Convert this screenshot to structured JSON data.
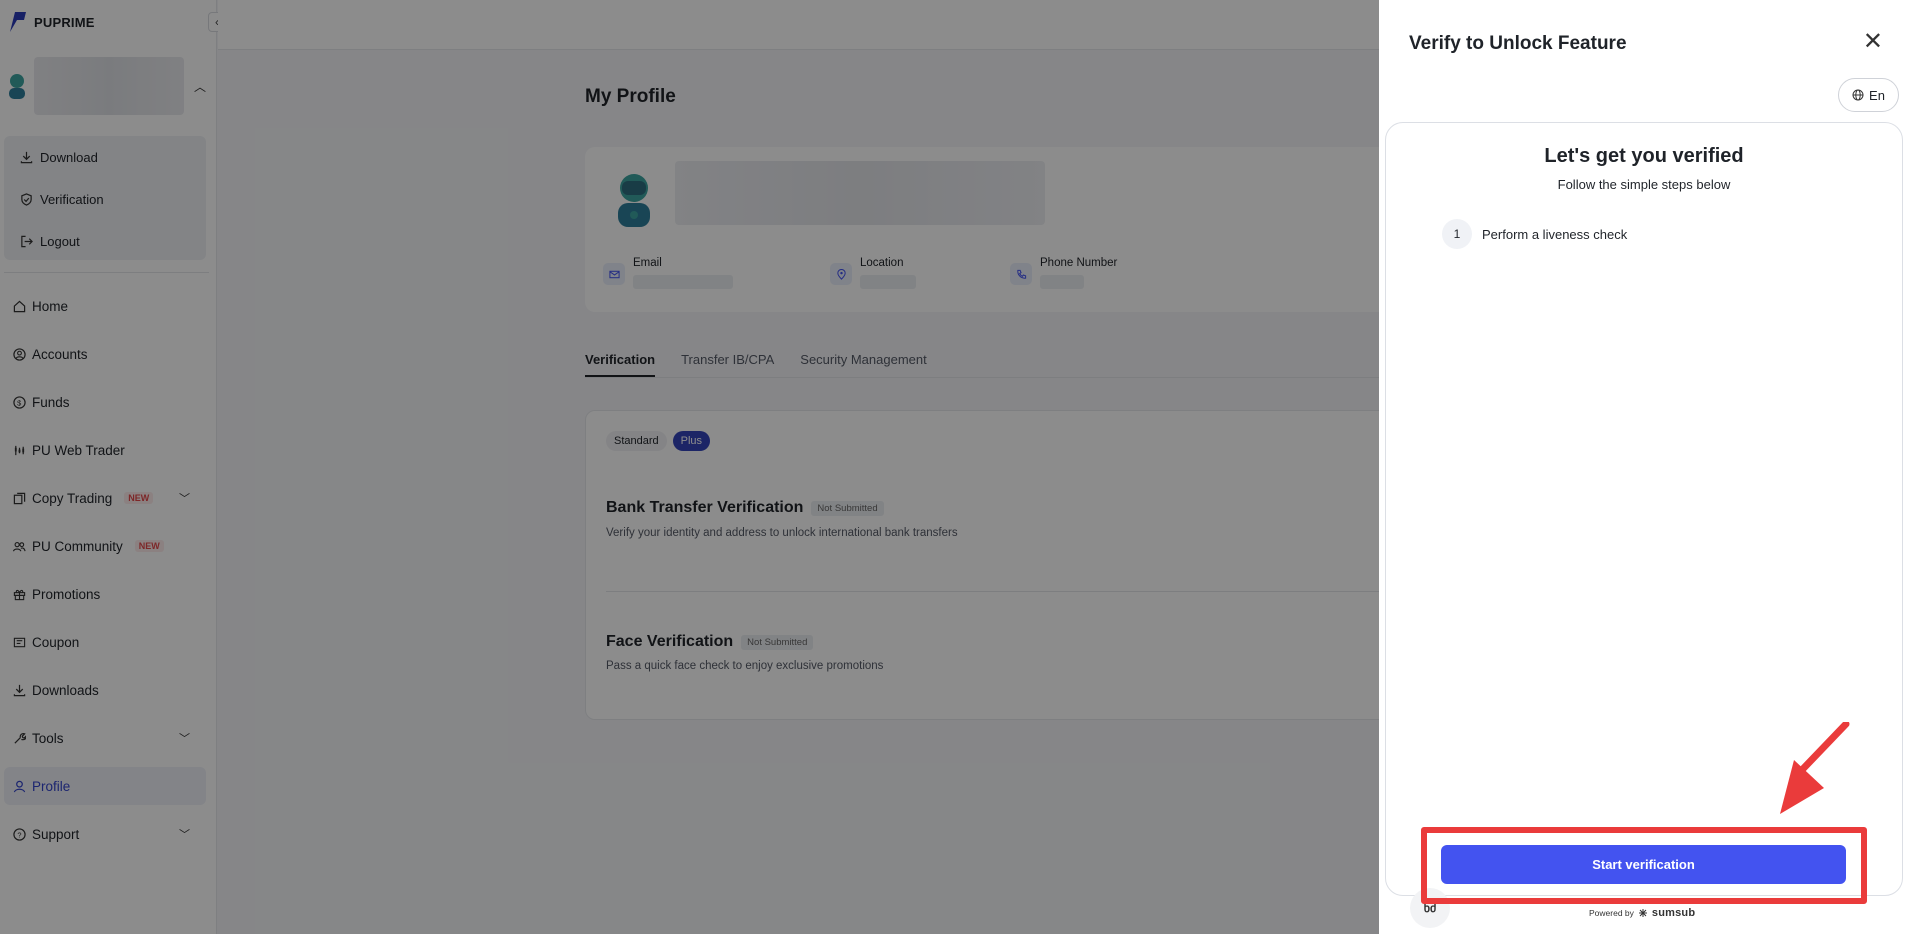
{
  "brand": {
    "name": "PUPRIME",
    "accent": "#4353f0",
    "highlight": "#ea3b3b"
  },
  "user_menu": [
    {
      "label": "Download",
      "icon": "download-icon"
    },
    {
      "label": "Verification",
      "icon": "shield-icon"
    },
    {
      "label": "Logout",
      "icon": "logout-icon"
    }
  ],
  "nav": [
    {
      "label": "Home",
      "icon": "home-icon"
    },
    {
      "label": "Accounts",
      "icon": "accounts-icon"
    },
    {
      "label": "Funds",
      "icon": "funds-icon"
    },
    {
      "label": "PU Web Trader",
      "icon": "chart-icon"
    },
    {
      "label": "Copy Trading",
      "icon": "copy-icon",
      "badge": "NEW",
      "expandable": true
    },
    {
      "label": "PU Community",
      "icon": "community-icon",
      "badge": "NEW"
    },
    {
      "label": "Promotions",
      "icon": "gift-icon"
    },
    {
      "label": "Coupon",
      "icon": "coupon-icon"
    },
    {
      "label": "Downloads",
      "icon": "download-icon"
    },
    {
      "label": "Tools",
      "icon": "tools-icon",
      "expandable": true
    },
    {
      "label": "Profile",
      "icon": "profile-icon",
      "active": true
    },
    {
      "label": "Support",
      "icon": "support-icon",
      "expandable": true
    }
  ],
  "main": {
    "title": "My Profile",
    "info": {
      "email": "Email",
      "location": "Location",
      "phone": "Phone Number"
    },
    "tabs": [
      "Verification",
      "Transfer IB/CPA",
      "Security Management"
    ],
    "toggle": {
      "standard": "Standard",
      "plus": "Plus"
    },
    "sections": [
      {
        "title": "Bank Transfer Verification",
        "status": "Not Submitted",
        "desc": "Verify your identity and address to unlock international bank transfers"
      },
      {
        "title": "Face Verification",
        "status": "Not Submitted",
        "desc": "Pass a quick face check to enjoy exclusive promotions"
      }
    ]
  },
  "drawer": {
    "title": "Verify to Unlock Feature",
    "lang": "En",
    "heading": "Let's get you verified",
    "subheading": "Follow the simple steps below",
    "step_num": "1",
    "step_label": "Perform a liveness check",
    "button": "Start verification",
    "avatar_text": "ნძ",
    "powered_by": "Powered by",
    "powered_brand": "sumsub"
  }
}
